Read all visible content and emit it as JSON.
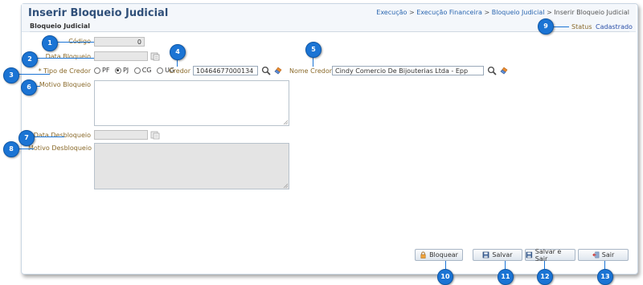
{
  "header": {
    "title": "Inserir Bloqueio Judicial",
    "breadcrumb": {
      "c1": "Execução",
      "sep": ">",
      "c2": "Execução Financeira",
      "c3": "Bloqueio Judicial",
      "c4": "Inserir Bloqueio Judicial"
    }
  },
  "section_title": "Bloqueio Judicial",
  "status": {
    "label": "Status",
    "value": "Cadastrado"
  },
  "form": {
    "codigo": {
      "label": "Código",
      "value": "0"
    },
    "data_bloqueio": {
      "label": "Data Bloqueio",
      "value": ""
    },
    "tipo_credor": {
      "label": "* Tipo de Credor",
      "options": [
        "PF",
        "PJ",
        "CG",
        "UG"
      ],
      "selected": "PJ"
    },
    "credor": {
      "label": "Credor",
      "value": "10464677000134"
    },
    "nome_credor": {
      "label": "Nome Credor",
      "value": "Cindy Comercio De Bijouterias Ltda - Epp"
    },
    "motivo_bloqueio": {
      "label": "Motivo Bloqueio",
      "value": ""
    },
    "data_desbloqueio": {
      "label": "Data Desbloqueio",
      "value": ""
    },
    "motivo_desbloqueio": {
      "label": "Motivo Desbloqueio",
      "value": ""
    }
  },
  "buttons": {
    "bloquear": "Bloquear",
    "salvar": "Salvar",
    "salvar_sair": "Salvar e Sair",
    "sair": "Sair"
  },
  "callouts": [
    "1",
    "2",
    "3",
    "4",
    "5",
    "6",
    "7",
    "8",
    "9",
    "10",
    "11",
    "12",
    "13"
  ],
  "colors": {
    "accent": "#1b74d4",
    "title": "#30507a",
    "label": "#8a6a2a",
    "status_value": "#2a4fa8"
  }
}
